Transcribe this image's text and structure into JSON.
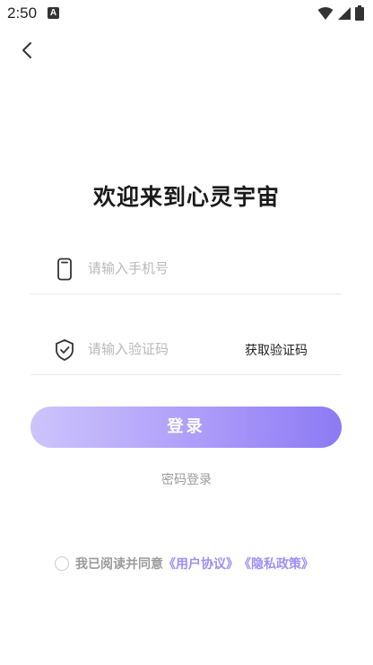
{
  "status_bar": {
    "time": "2:50",
    "notification_icon": "A"
  },
  "page": {
    "title": "欢迎来到心灵宇宙"
  },
  "phone_field": {
    "placeholder": "请输入手机号",
    "value": ""
  },
  "code_field": {
    "placeholder": "请输入验证码",
    "value": "",
    "get_code_label": "获取验证码"
  },
  "login_button": {
    "label": "登录"
  },
  "password_login": {
    "label": "密码登录"
  },
  "agreement": {
    "prefix": "我已阅读并同意",
    "user_agreement": "《用户协议》",
    "privacy_policy": "《隐私政策》",
    "checked": false
  },
  "colors": {
    "accent": "#8c7af4",
    "link": "#9d8ff7",
    "muted": "#9a9a9a"
  }
}
